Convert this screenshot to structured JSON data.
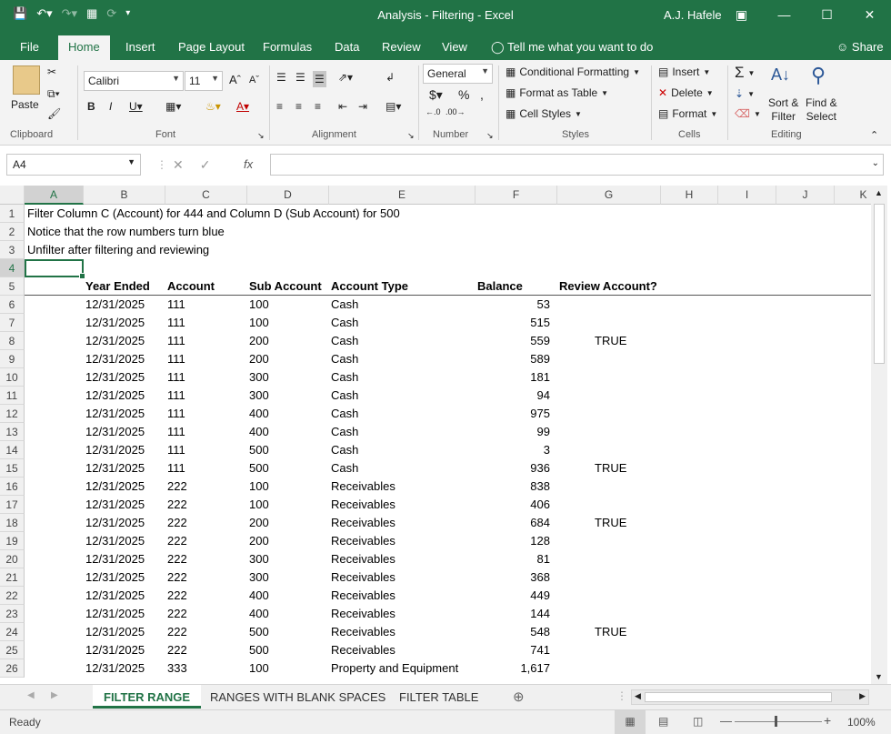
{
  "window": {
    "title": "Analysis - Filtering  -  Excel",
    "user": "A.J. Hafele"
  },
  "ribbon_tabs": [
    "File",
    "Home",
    "Insert",
    "Page Layout",
    "Formulas",
    "Data",
    "Review",
    "View"
  ],
  "tell_me": "Tell me what you want to do",
  "share": "Share",
  "clipboard": {
    "paste": "Paste",
    "label": "Clipboard"
  },
  "font": {
    "name": "Calibri",
    "size": "11",
    "label": "Font"
  },
  "alignment": {
    "label": "Alignment"
  },
  "number": {
    "format": "General",
    "label": "Number"
  },
  "styles": {
    "cond": "Conditional Formatting",
    "table": "Format as Table",
    "cell": "Cell Styles",
    "label": "Styles"
  },
  "cells": {
    "insert": "Insert",
    "delete": "Delete",
    "format": "Format",
    "label": "Cells"
  },
  "editing": {
    "sort1": "Sort &",
    "sort2": "Filter",
    "find1": "Find &",
    "find2": "Select",
    "label": "Editing"
  },
  "formula": {
    "namebox": "A4",
    "content": ""
  },
  "columns": [
    "A",
    "B",
    "C",
    "D",
    "E",
    "F",
    "G",
    "H",
    "I",
    "J",
    "K"
  ],
  "notes": [
    "Filter Column C (Account) for 444 and Column D (Sub Account) for 500",
    "Notice that the row numbers turn blue",
    "Unfilter after filtering and reviewing"
  ],
  "headers": {
    "year": "Year Ended",
    "account": "Account",
    "sub": "Sub Account",
    "type": "Account Type",
    "balance": "Balance",
    "review": "Review Account?"
  },
  "rows": [
    {
      "n": "6",
      "d": "12/31/2025",
      "a": "111",
      "s": "100",
      "t": "Cash",
      "b": "53",
      "r": ""
    },
    {
      "n": "7",
      "d": "12/31/2025",
      "a": "111",
      "s": "100",
      "t": "Cash",
      "b": "515",
      "r": ""
    },
    {
      "n": "8",
      "d": "12/31/2025",
      "a": "111",
      "s": "200",
      "t": "Cash",
      "b": "559",
      "r": "TRUE"
    },
    {
      "n": "9",
      "d": "12/31/2025",
      "a": "111",
      "s": "200",
      "t": "Cash",
      "b": "589",
      "r": ""
    },
    {
      "n": "10",
      "d": "12/31/2025",
      "a": "111",
      "s": "300",
      "t": "Cash",
      "b": "181",
      "r": ""
    },
    {
      "n": "11",
      "d": "12/31/2025",
      "a": "111",
      "s": "300",
      "t": "Cash",
      "b": "94",
      "r": ""
    },
    {
      "n": "12",
      "d": "12/31/2025",
      "a": "111",
      "s": "400",
      "t": "Cash",
      "b": "975",
      "r": ""
    },
    {
      "n": "13",
      "d": "12/31/2025",
      "a": "111",
      "s": "400",
      "t": "Cash",
      "b": "99",
      "r": ""
    },
    {
      "n": "14",
      "d": "12/31/2025",
      "a": "111",
      "s": "500",
      "t": "Cash",
      "b": "3",
      "r": ""
    },
    {
      "n": "15",
      "d": "12/31/2025",
      "a": "111",
      "s": "500",
      "t": "Cash",
      "b": "936",
      "r": "TRUE"
    },
    {
      "n": "16",
      "d": "12/31/2025",
      "a": "222",
      "s": "100",
      "t": "Receivables",
      "b": "838",
      "r": ""
    },
    {
      "n": "17",
      "d": "12/31/2025",
      "a": "222",
      "s": "100",
      "t": "Receivables",
      "b": "406",
      "r": ""
    },
    {
      "n": "18",
      "d": "12/31/2025",
      "a": "222",
      "s": "200",
      "t": "Receivables",
      "b": "684",
      "r": "TRUE"
    },
    {
      "n": "19",
      "d": "12/31/2025",
      "a": "222",
      "s": "200",
      "t": "Receivables",
      "b": "128",
      "r": ""
    },
    {
      "n": "20",
      "d": "12/31/2025",
      "a": "222",
      "s": "300",
      "t": "Receivables",
      "b": "81",
      "r": ""
    },
    {
      "n": "21",
      "d": "12/31/2025",
      "a": "222",
      "s": "300",
      "t": "Receivables",
      "b": "368",
      "r": ""
    },
    {
      "n": "22",
      "d": "12/31/2025",
      "a": "222",
      "s": "400",
      "t": "Receivables",
      "b": "449",
      "r": ""
    },
    {
      "n": "23",
      "d": "12/31/2025",
      "a": "222",
      "s": "400",
      "t": "Receivables",
      "b": "144",
      "r": ""
    },
    {
      "n": "24",
      "d": "12/31/2025",
      "a": "222",
      "s": "500",
      "t": "Receivables",
      "b": "548",
      "r": "TRUE"
    },
    {
      "n": "25",
      "d": "12/31/2025",
      "a": "222",
      "s": "500",
      "t": "Receivables",
      "b": "741",
      "r": ""
    },
    {
      "n": "26",
      "d": "12/31/2025",
      "a": "333",
      "s": "100",
      "t": "Property and Equipment",
      "b": "1,617",
      "r": ""
    }
  ],
  "sheets": [
    "FILTER RANGE",
    "RANGES WITH BLANK SPACES",
    "FILTER TABLE"
  ],
  "status": {
    "ready": "Ready",
    "zoom": "100%"
  }
}
